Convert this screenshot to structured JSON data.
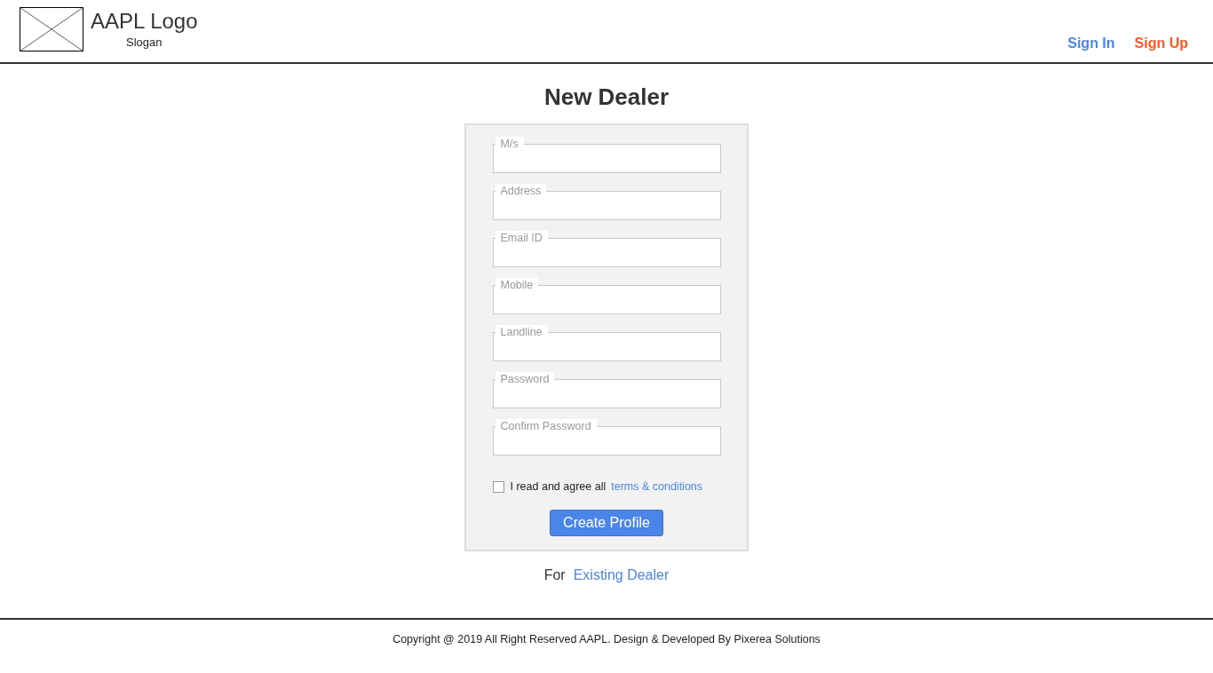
{
  "header": {
    "logo_text": "AAPL Logo",
    "slogan": "Slogan",
    "nav": [
      {
        "label": "Sign In",
        "kind": "signin"
      },
      {
        "label": "Sign Up",
        "kind": "signup"
      }
    ]
  },
  "title": "New Dealer",
  "form": {
    "fields": [
      {
        "label": "M/s"
      },
      {
        "label": "Address"
      },
      {
        "label": "Email ID"
      },
      {
        "label": "Mobile"
      },
      {
        "label": "Landline"
      },
      {
        "label": "Password"
      },
      {
        "label": "Confirm Password"
      }
    ],
    "agree": {
      "checked": false,
      "text": "I read and agree all",
      "link": "terms & conditions"
    },
    "submit": "Create Profile"
  },
  "existing": {
    "text": "For",
    "link": "Existing Dealer"
  },
  "footer": "Copyright @ 2019 All Right Reserved AAPL. Design & Developed By Pixerea Solutions"
}
